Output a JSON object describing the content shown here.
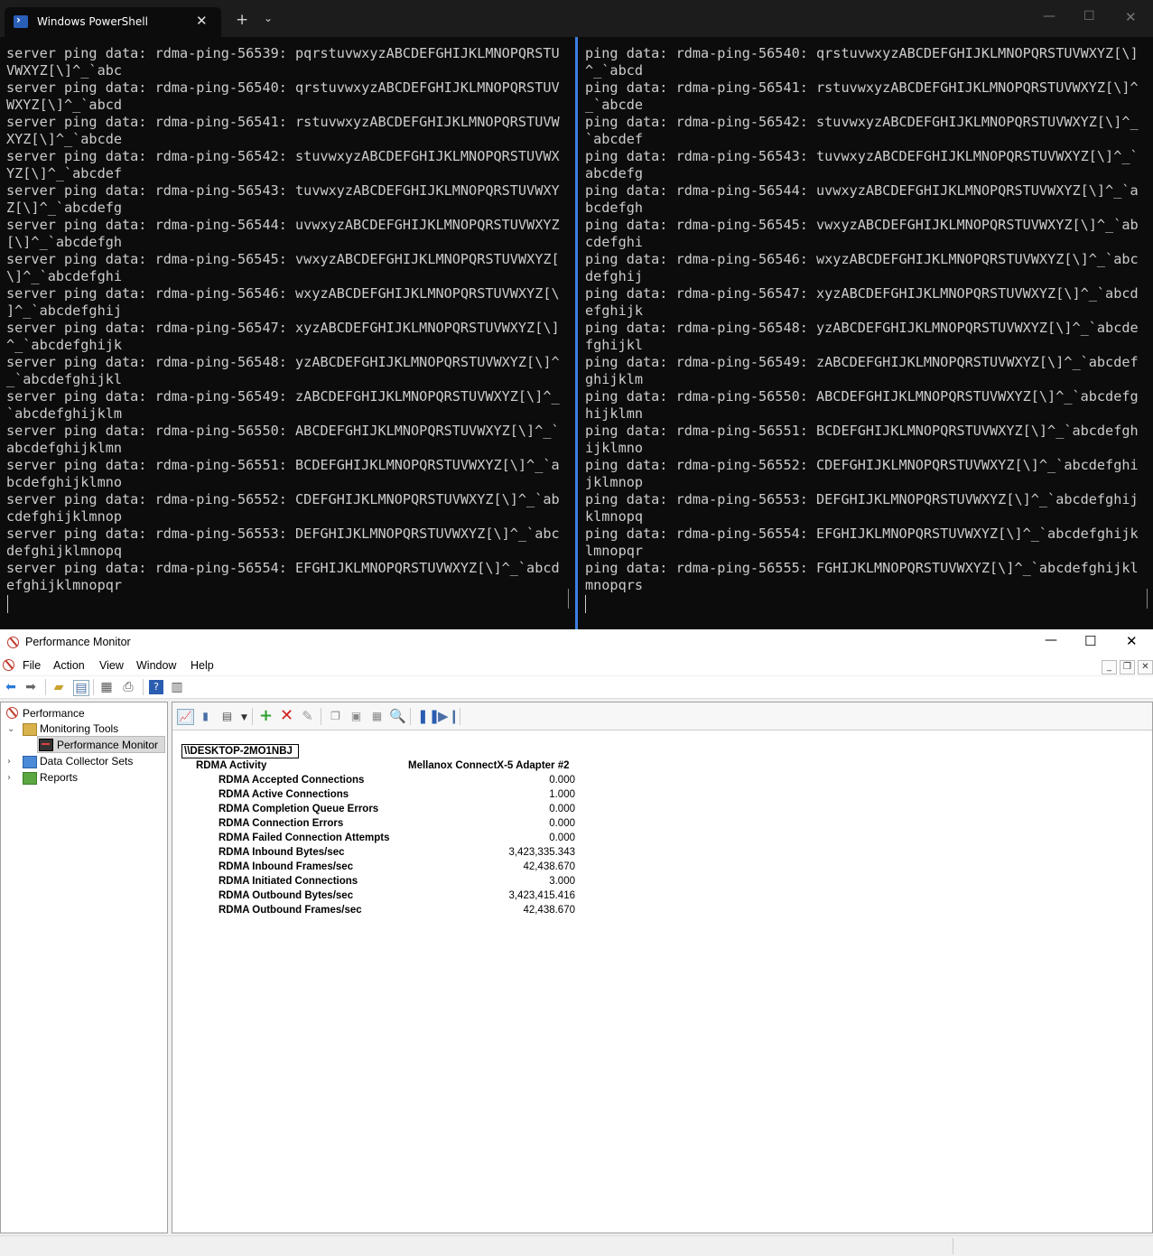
{
  "terminal": {
    "tab_title": "Windows PowerShell",
    "tab_close": "✕",
    "new_tab": "+",
    "dropdown": "⌄",
    "window_controls": {
      "minimize": "—",
      "maximize": "☐",
      "close": "✕"
    },
    "left_pane_text": "server ping data: rdma-ping-56539: pqrstuvwxyzABCDEFGHIJKLMNOPQRSTU\nVWXYZ[\\]^_`abc\nserver ping data: rdma-ping-56540: qrstuvwxyzABCDEFGHIJKLMNOPQRSTUV\nWXYZ[\\]^_`abcd\nserver ping data: rdma-ping-56541: rstuvwxyzABCDEFGHIJKLMNOPQRSTUVW\nXYZ[\\]^_`abcde\nserver ping data: rdma-ping-56542: stuvwxyzABCDEFGHIJKLMNOPQRSTUVWX\nYZ[\\]^_`abcdef\nserver ping data: rdma-ping-56543: tuvwxyzABCDEFGHIJKLMNOPQRSTUVWXY\nZ[\\]^_`abcdefg\nserver ping data: rdma-ping-56544: uvwxyzABCDEFGHIJKLMNOPQRSTUVWXYZ\n[\\]^_`abcdefgh\nserver ping data: rdma-ping-56545: vwxyzABCDEFGHIJKLMNOPQRSTUVWXYZ[\n\\]^_`abcdefghi\nserver ping data: rdma-ping-56546: wxyzABCDEFGHIJKLMNOPQRSTUVWXYZ[\\\n]^_`abcdefghij\nserver ping data: rdma-ping-56547: xyzABCDEFGHIJKLMNOPQRSTUVWXYZ[\\]\n^_`abcdefghijk\nserver ping data: rdma-ping-56548: yzABCDEFGHIJKLMNOPQRSTUVWXYZ[\\]^\n_`abcdefghijkl\nserver ping data: rdma-ping-56549: zABCDEFGHIJKLMNOPQRSTUVWXYZ[\\]^_\n`abcdefghijklm\nserver ping data: rdma-ping-56550: ABCDEFGHIJKLMNOPQRSTUVWXYZ[\\]^_`\nabcdefghijklmn\nserver ping data: rdma-ping-56551: BCDEFGHIJKLMNOPQRSTUVWXYZ[\\]^_`a\nbcdefghijklmno\nserver ping data: rdma-ping-56552: CDEFGHIJKLMNOPQRSTUVWXYZ[\\]^_`ab\ncdefghijklmnop\nserver ping data: rdma-ping-56553: DEFGHIJKLMNOPQRSTUVWXYZ[\\]^_`abc\ndefghijklmnopq\nserver ping data: rdma-ping-56554: EFGHIJKLMNOPQRSTUVWXYZ[\\]^_`abcd\nefghijklmnopqr",
    "right_pane_text": "ping data: rdma-ping-56540: qrstuvwxyzABCDEFGHIJKLMNOPQRSTUVWXYZ[\\]\n^_`abcd\nping data: rdma-ping-56541: rstuvwxyzABCDEFGHIJKLMNOPQRSTUVWXYZ[\\]^\n_`abcde\nping data: rdma-ping-56542: stuvwxyzABCDEFGHIJKLMNOPQRSTUVWXYZ[\\]^_\n`abcdef\nping data: rdma-ping-56543: tuvwxyzABCDEFGHIJKLMNOPQRSTUVWXYZ[\\]^_`\nabcdefg\nping data: rdma-ping-56544: uvwxyzABCDEFGHIJKLMNOPQRSTUVWXYZ[\\]^_`a\nbcdefgh\nping data: rdma-ping-56545: vwxyzABCDEFGHIJKLMNOPQRSTUVWXYZ[\\]^_`ab\ncdefghi\nping data: rdma-ping-56546: wxyzABCDEFGHIJKLMNOPQRSTUVWXYZ[\\]^_`abc\ndefghij\nping data: rdma-ping-56547: xyzABCDEFGHIJKLMNOPQRSTUVWXYZ[\\]^_`abcd\nefghijk\nping data: rdma-ping-56548: yzABCDEFGHIJKLMNOPQRSTUVWXYZ[\\]^_`abcde\nfghijkl\nping data: rdma-ping-56549: zABCDEFGHIJKLMNOPQRSTUVWXYZ[\\]^_`abcdef\nghijklm\nping data: rdma-ping-56550: ABCDEFGHIJKLMNOPQRSTUVWXYZ[\\]^_`abcdefg\nhijklmn\nping data: rdma-ping-56551: BCDEFGHIJKLMNOPQRSTUVWXYZ[\\]^_`abcdefgh\nijklmno\nping data: rdma-ping-56552: CDEFGHIJKLMNOPQRSTUVWXYZ[\\]^_`abcdefghi\njklmnop\nping data: rdma-ping-56553: DEFGHIJKLMNOPQRSTUVWXYZ[\\]^_`abcdefghij\nklmnopq\nping data: rdma-ping-56554: EFGHIJKLMNOPQRSTUVWXYZ[\\]^_`abcdefghijk\nlmnopqr\nping data: rdma-ping-56555: FGHIJKLMNOPQRSTUVWXYZ[\\]^_`abcdefghijkl\nmnopqrs",
    "colors": {
      "background": "#0c0c0c",
      "foreground": "#cccccc",
      "divider": "#3c7ee0"
    }
  },
  "perfmon": {
    "title": "Performance Monitor",
    "window_controls": {
      "minimize": "—",
      "maximize": "☐",
      "close": "✕"
    },
    "menu": {
      "file": "File",
      "action": "Action",
      "view": "View",
      "window": "Window",
      "help": "Help"
    },
    "mdi_controls": {
      "minimize": "_",
      "restore": "❐",
      "close": "✕"
    },
    "toolbar_icons": [
      "back-arrow-icon",
      "forward-arrow-icon",
      "up-folder-icon",
      "show-hide-tree-icon",
      "export-list-icon",
      "print-icon",
      "help-icon",
      "console-icon"
    ],
    "tree": {
      "root": "Performance",
      "monitoring_tools": "Monitoring Tools",
      "performance_monitor": "Performance Monitor",
      "data_collector_sets": "Data Collector Sets",
      "reports": "Reports"
    },
    "report": {
      "machine": "\\\\DESKTOP-2MO1NBJ",
      "object": "RDMA Activity",
      "instance": "Mellanox ConnectX-5 Adapter #2",
      "counters": [
        {
          "name": "RDMA Accepted Connections",
          "value": "0.000"
        },
        {
          "name": "RDMA Active Connections",
          "value": "1.000"
        },
        {
          "name": "RDMA Completion Queue Errors",
          "value": "0.000"
        },
        {
          "name": "RDMA Connection Errors",
          "value": "0.000"
        },
        {
          "name": "RDMA Failed Connection Attempts",
          "value": "0.000"
        },
        {
          "name": "RDMA Inbound Bytes/sec",
          "value": "3,423,335.343"
        },
        {
          "name": "RDMA Inbound Frames/sec",
          "value": "42,438.670"
        },
        {
          "name": "RDMA Initiated Connections",
          "value": "3.000"
        },
        {
          "name": "RDMA Outbound Bytes/sec",
          "value": "3,423,415.416"
        },
        {
          "name": "RDMA Outbound Frames/sec",
          "value": "42,438.670"
        }
      ]
    }
  }
}
